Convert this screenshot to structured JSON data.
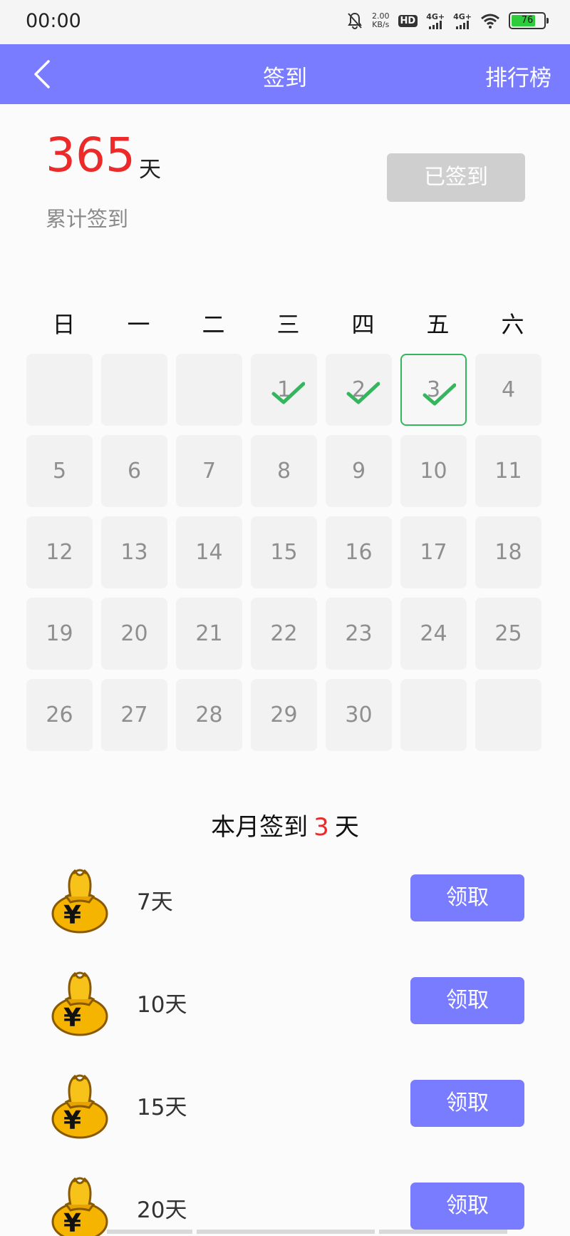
{
  "status": {
    "time": "00:00",
    "speed_value": "2.00",
    "speed_unit": "KB/s",
    "hd": "HD",
    "net1": "4G+",
    "net2": "4G+",
    "battery": "76",
    "battery_level": 0.76
  },
  "nav": {
    "title": "签到",
    "right": "排行榜"
  },
  "summary": {
    "total_days": "365",
    "unit": "天",
    "caption": "累计签到",
    "signed_button": "已签到"
  },
  "calendar": {
    "weekdays": [
      "日",
      "一",
      "二",
      "三",
      "四",
      "五",
      "六"
    ],
    "leading_blanks": 3,
    "days_in_month": 30,
    "checked_days": [
      1,
      2,
      3
    ],
    "today": 3
  },
  "monthly": {
    "prefix": "本月签到",
    "count": "3",
    "suffix": "天"
  },
  "rewards": [
    {
      "label": "7天",
      "button": "领取"
    },
    {
      "label": "10天",
      "button": "领取"
    },
    {
      "label": "15天",
      "button": "领取"
    },
    {
      "label": "20天",
      "button": "领取"
    }
  ],
  "colors": {
    "primary": "#7a7cff",
    "accent_red": "#ec2a2a",
    "check_green": "#35b65e"
  }
}
